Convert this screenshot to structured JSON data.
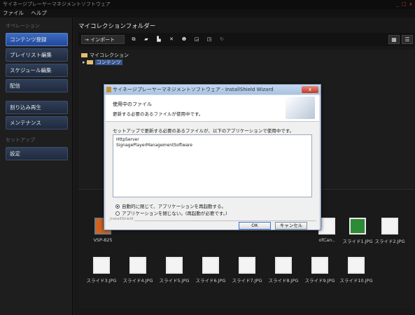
{
  "window": {
    "title": "サイネージプレーヤーマネジメントソフトウェア",
    "controls": "_ □ x"
  },
  "menubar": {
    "items": [
      "ファイル",
      "ヘルプ"
    ]
  },
  "sidebar": {
    "section_operation": "オペレーション",
    "items": [
      "コンテンツ登録",
      "プレイリスト編集",
      "スケジュール編集",
      "配信",
      "割り込み再生",
      "メンテナンス"
    ],
    "section_setup": "セットアップ",
    "setup_items": [
      "設定"
    ]
  },
  "main": {
    "title": "マイコレクションフォルダー",
    "toolbar": {
      "import_label": "→ インポート"
    },
    "tree": {
      "root": "マイコレクション",
      "child": "コンテンツ"
    }
  },
  "thumbnails": [
    {
      "label": "VSP-825",
      "style": "orange"
    },
    {
      "label": "ofCan..",
      "style": "white"
    },
    {
      "label": "スライド1.JPG",
      "style": "green"
    },
    {
      "label": "スライド2.JPG",
      "style": "white"
    },
    {
      "label": "スライド3.JPG",
      "style": "white"
    },
    {
      "label": "スライド4.JPG",
      "style": "white"
    },
    {
      "label": "スライド5.JPG",
      "style": "white"
    },
    {
      "label": "スライド6.JPG",
      "style": "white"
    },
    {
      "label": "スライド7.JPG",
      "style": "white"
    },
    {
      "label": "スライド8.JPG",
      "style": "white"
    },
    {
      "label": "スライド9.JPG",
      "style": "white"
    },
    {
      "label": "スライド10.JPG",
      "style": "white"
    }
  ],
  "dialog": {
    "title": "サイネージプレーヤーマネジメントソフトウェア - InstallShield Wizard",
    "close_label": "x",
    "header_title": "使用中のファイル",
    "header_subtitle": "更新する必要のあるファイルが使用中です。",
    "description": "セットアップで更新する必要のあるファイルが、以下のアプリケーションで使用中です。",
    "files": [
      "HttpServer",
      "SignagePlayerManagementSoftware"
    ],
    "option_close": "自動的に閉じて、アプリケーションを再起動する。",
    "option_keep": "アプリケーションを閉じない。(再起動が必要です。)",
    "footer_brand": "InstallShield",
    "ok_label": "OK",
    "cancel_label": "キャンセル"
  },
  "colors": {
    "accent_nav": "#23479a",
    "dialog_bg": "#f0f0f0",
    "app_bg": "#1b1b1b"
  }
}
